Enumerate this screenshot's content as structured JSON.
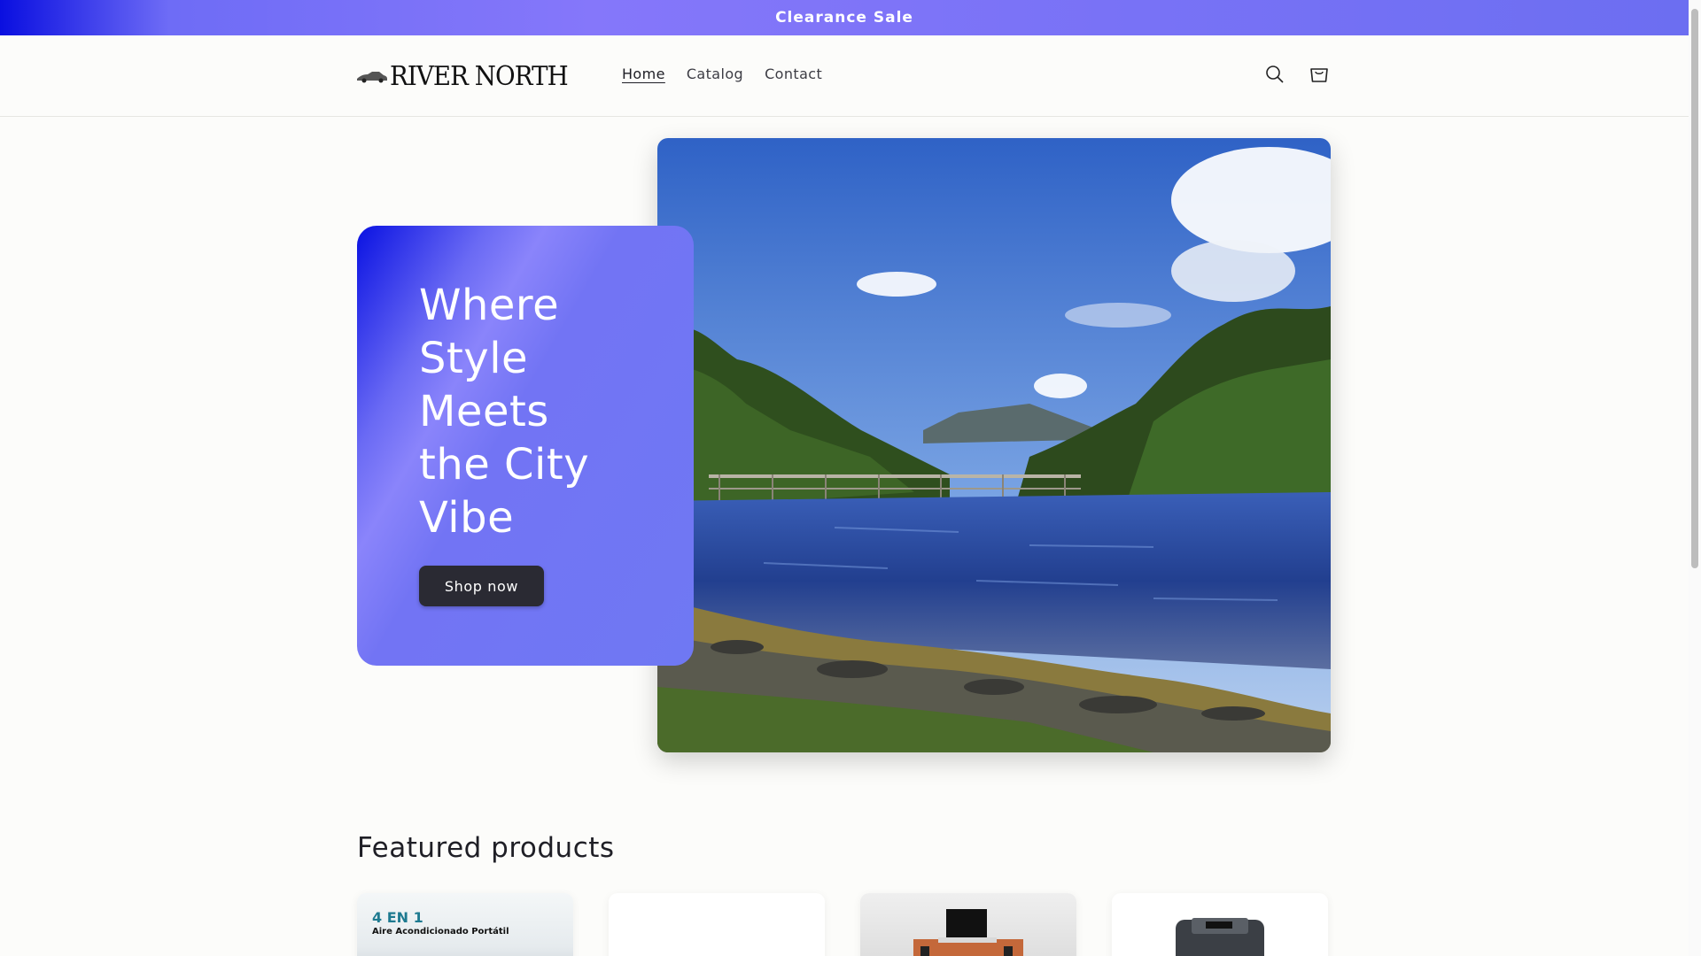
{
  "announcement": {
    "text": "Clearance Sale"
  },
  "header": {
    "logo_text": "RIVER NORTH",
    "nav": [
      {
        "label": "Home",
        "active": true
      },
      {
        "label": "Catalog",
        "active": false
      },
      {
        "label": "Contact",
        "active": false
      }
    ],
    "icons": [
      "search-icon",
      "cart-icon"
    ]
  },
  "hero": {
    "title": "Where Style Meets the City Vibe",
    "button_label": "Shop now"
  },
  "featured": {
    "title": "Featured products",
    "products": [
      {
        "badge": "4 EN 1",
        "subtitle": "Aire Acondicionado Portátil"
      },
      {},
      {},
      {}
    ]
  },
  "colors": {
    "accent": "#7b73f7",
    "button": "#2a2a33"
  }
}
